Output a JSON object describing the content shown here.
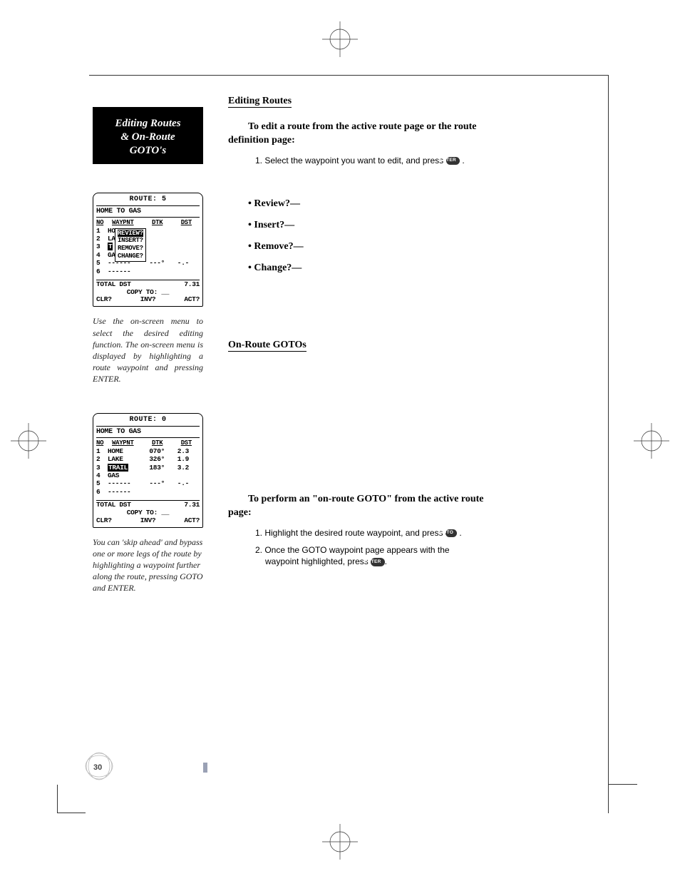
{
  "sidebar": {
    "tab_lines": [
      "Editing Routes",
      "& On-Route",
      "GOTO's"
    ],
    "screen1": {
      "title": "ROUTE: 5",
      "name": "HOME TO GAS",
      "headers": [
        "NO",
        "WAYPNT",
        "DTK",
        "DST"
      ],
      "rows": [
        {
          "n": "1",
          "wp": "HOME",
          "dtk": "",
          "dst": ""
        },
        {
          "n": "2",
          "wp": "LA",
          "dtk": "",
          "dst": ""
        },
        {
          "n": "3",
          "wp": "T",
          "dtk": "",
          "dst": ""
        },
        {
          "n": "4",
          "wp": "GA",
          "dtk": "",
          "dst": ""
        },
        {
          "n": "5",
          "wp": "------",
          "dtk": "---°",
          "dst": "-.-"
        },
        {
          "n": "6",
          "wp": "------",
          "dtk": "",
          "dst": ""
        }
      ],
      "popup": [
        "REVIEW?",
        "INSERT?",
        "REMOVE?",
        "CHANGE?"
      ],
      "total_label": "TOTAL DST",
      "total_val": "7.31",
      "copy": "COPY TO: __",
      "bottom": [
        "CLR?",
        "INV?",
        "ACT?"
      ]
    },
    "caption1": "Use the on-screen menu to select the desired editing function. The on-screen menu is displayed by highlighting a route waypoint and pressing ENTER.",
    "screen2": {
      "title": "ROUTE: 0",
      "name": "HOME TO GAS",
      "headers": [
        "NO",
        "WAYPNT",
        "DTK",
        "DST"
      ],
      "rows": [
        {
          "n": "1",
          "wp": "HOME",
          "dtk": "070°",
          "dst": "2.3"
        },
        {
          "n": "2",
          "wp": "LAKE",
          "dtk": "326°",
          "dst": "1.9"
        },
        {
          "n": "3",
          "wp": "TRAIL",
          "dtk": "183°",
          "dst": "3.2",
          "hl": true
        },
        {
          "n": "4",
          "wp": "GAS",
          "dtk": "",
          "dst": ""
        },
        {
          "n": "5",
          "wp": "------",
          "dtk": "---°",
          "dst": "-.-"
        },
        {
          "n": "6",
          "wp": "------",
          "dtk": "",
          "dst": ""
        }
      ],
      "total_label": "TOTAL DST",
      "total_val": "7.31",
      "copy": "COPY TO: __",
      "bottom": [
        "CLR?",
        "INV?",
        "ACT?"
      ]
    },
    "caption2": "You can 'skip ahead' and bypass one or more legs of the route by highlighting a waypoint further along the route, pressing GOTO and ENTER."
  },
  "main": {
    "heading1": "Editing Routes",
    "instr1": "To edit a route from the active route page or the route definition page:",
    "step1_pre": "1. Select the waypoint you want to edit, and press ",
    "step1_post": " .",
    "key_enter": "ENTER",
    "bullets": [
      "Review?—",
      "Insert?—",
      "Remove?—",
      "Change?—"
    ],
    "heading2": "On-Route GOTOs",
    "instr2": "To perform an \"on-route GOTO\" from the active route page:",
    "step2a_pre": "1. Highlight the desired route waypoint, and press ",
    "step2a_post": " .",
    "key_goto": "GOTO",
    "step2b_pre": "2. Once the GOTO waypoint page appears with the waypoint highlighted, press ",
    "step2b_post": "."
  },
  "page_number": "30"
}
